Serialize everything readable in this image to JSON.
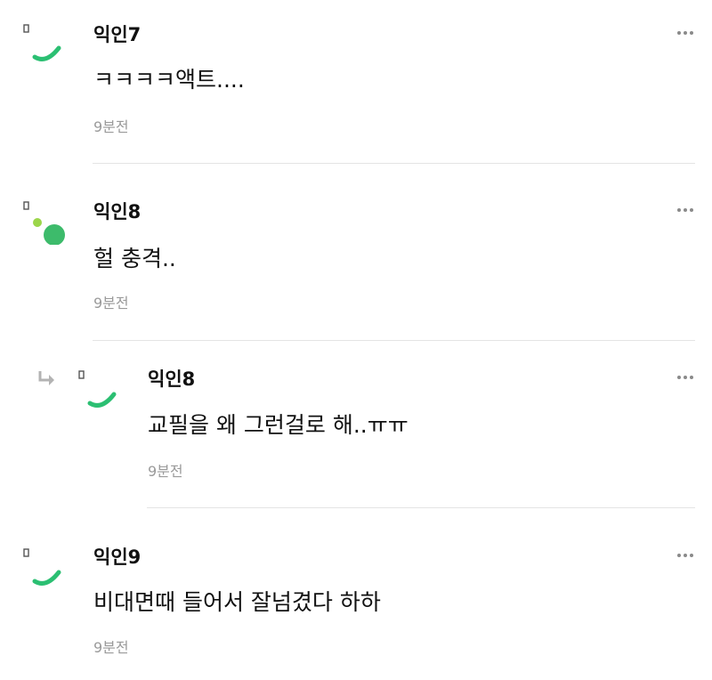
{
  "comments": [
    {
      "author": "익인7",
      "text": "ㅋㅋㅋㅋ액트....",
      "time": "9분전",
      "avatar": "arc-avatar-icon"
    },
    {
      "author": "익인8",
      "text": "헐 충격..",
      "time": "9분전",
      "avatar": "dots-avatar-icon"
    },
    {
      "author": "익인8",
      "text": "교필을 왜 그런걸로 해..ㅠㅠ",
      "time": "9분전",
      "avatar": "arc-avatar-icon",
      "is_reply": true
    },
    {
      "author": "익인9",
      "text": "비대면때 들어서 잘넘겼다 하하",
      "time": "9분전",
      "avatar": "arc-avatar-icon"
    }
  ],
  "colors": {
    "avatar_green": "#2bbf72",
    "avatar_lime": "#9cd64a",
    "avatar_circle": "#3dbb6b",
    "time_gray": "#9a9a9a",
    "divider": "#e4e4e4"
  },
  "icons": {
    "more": "more-dots-icon",
    "reply": "reply-arrow-icon"
  }
}
